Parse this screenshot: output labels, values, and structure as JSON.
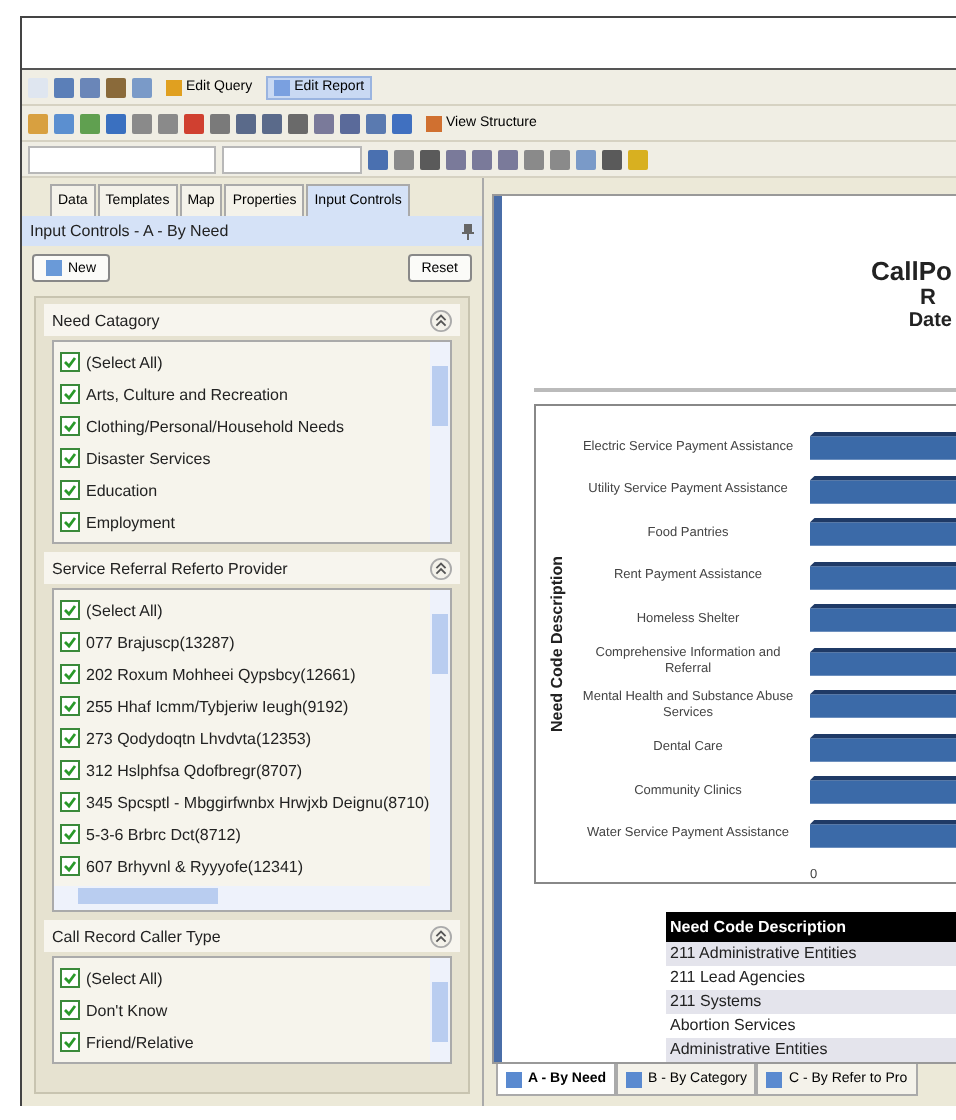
{
  "toolbar": {
    "buttons": [
      {
        "label": "Edit Query",
        "selected": false
      },
      {
        "label": "Edit Report",
        "selected": true
      }
    ],
    "view_structure": "View Structure"
  },
  "panel_tabs": [
    {
      "label": "Data",
      "selected": false
    },
    {
      "label": "Templates",
      "selected": false
    },
    {
      "label": "Map",
      "selected": false
    },
    {
      "label": "Properties",
      "selected": false
    },
    {
      "label": "Input Controls",
      "selected": true
    }
  ],
  "panel_title": "Input Controls - A - By Need",
  "new_button": "New",
  "reset_button": "Reset",
  "groups": [
    {
      "title": "Need Catagory",
      "horizontal_scroll": false,
      "items": [
        {
          "label": "(Select All)",
          "checked": true
        },
        {
          "label": "Arts, Culture and Recreation",
          "checked": true
        },
        {
          "label": "Clothing/Personal/Household Needs",
          "checked": true
        },
        {
          "label": "Disaster Services",
          "checked": true
        },
        {
          "label": "Education",
          "checked": true
        },
        {
          "label": "Employment",
          "checked": true
        }
      ]
    },
    {
      "title": "Service Referral Referto Provider",
      "horizontal_scroll": true,
      "items": [
        {
          "label": "(Select All)",
          "checked": true
        },
        {
          "label": "077 Brajuscp(13287)",
          "checked": true
        },
        {
          "label": "202 Roxum Mohheei Qypsbcy(12661)",
          "checked": true
        },
        {
          "label": "255 Hhaf Icmm/Tybjeriw Ieugh(9192)",
          "checked": true
        },
        {
          "label": "273 Qodydoqtn Lhvdvta(12353)",
          "checked": true
        },
        {
          "label": "312 Hslphfsa Qdofbregr(8707)",
          "checked": true
        },
        {
          "label": "345 Spcsptl - Mbggirfwnbx Hrwjxb Deignu(8710)",
          "checked": true
        },
        {
          "label": "5-3-6 Brbrc Dct(8712)",
          "checked": true
        },
        {
          "label": "607 Brhyvnl & Ryyyofe(12341)",
          "checked": true
        }
      ]
    },
    {
      "title": "Call Record Caller Type",
      "horizontal_scroll": false,
      "items": [
        {
          "label": "(Select All)",
          "checked": true
        },
        {
          "label": "Don't Know",
          "checked": true
        },
        {
          "label": "Friend/Relative",
          "checked": true
        }
      ]
    }
  ],
  "report": {
    "title_lines": [
      "CallPo",
      "R",
      "Date"
    ],
    "chart": {
      "y_axis_label": "Need Code Description",
      "x_tick": "0",
      "categories": [
        "Electric Service Payment Assistance",
        "Utility Service Payment Assistance",
        "Food Pantries",
        "Rent Payment Assistance",
        "Homeless Shelter",
        "Comprehensive Information and Referral",
        "Mental Health and Substance Abuse Services",
        "Dental Care",
        "Community Clinics",
        "Water Service Payment Assistance"
      ]
    },
    "table": {
      "column": "Need Code Description",
      "rows": [
        "211 Administrative Entities",
        "211 Lead Agencies",
        "211 Systems",
        "Abortion Services",
        "Administrative Entities"
      ]
    }
  },
  "report_tabs": [
    {
      "label": "A - By Need",
      "selected": true
    },
    {
      "label": "B - By Category",
      "selected": false
    },
    {
      "label": "C - By Refer to Pro",
      "selected": false
    }
  ]
}
